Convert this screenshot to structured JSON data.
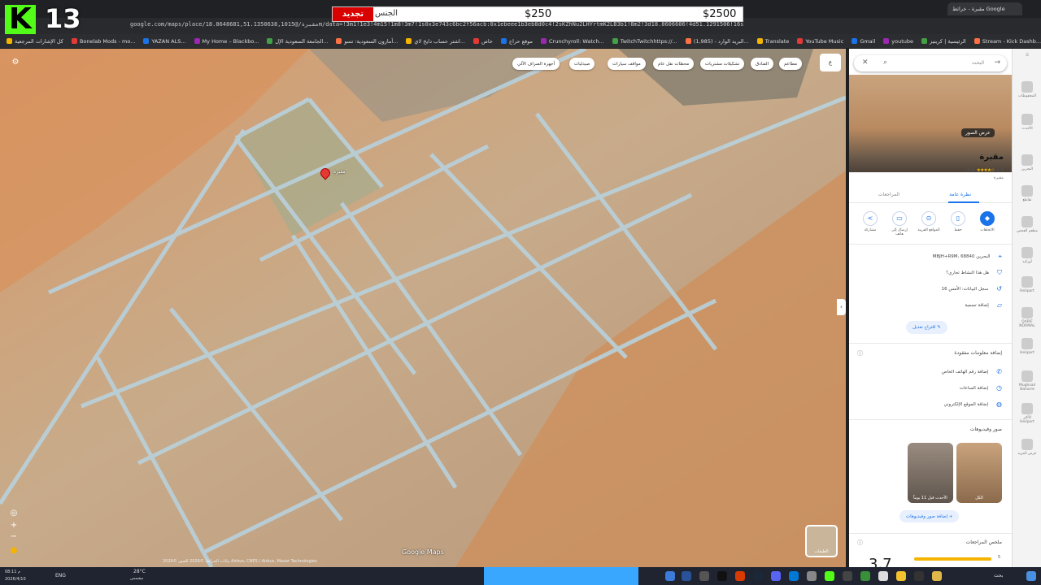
{
  "stream": {
    "logo_letter": "K",
    "count": "13",
    "overlay_red": "تجديد",
    "overlay_label": "الجنس",
    "price_small": "$250",
    "price_big": "$2500"
  },
  "browser": {
    "url": "google.com/maps/place/مقبرة/@18.8648681,51.1350638,1015m/data=!3m1!1e3!4m15!1m8!3m7!1s0x3e743c6bc2f56acb:0x1ebeee1b3eb8d0c4!2sKZhNu2LHYrtmK2LB3b1!8m2!3d18.8606606!4d51.1291506!16s",
    "active_tab": "مقبرة - خرائط Google",
    "bookmarks": [
      "كل الإشارات المرجعية",
      "Bonelab Mods - mo...",
      "YAZAN ALS...",
      "My Home – Blackbo...",
      "الجامعة السعودية الإل...",
      "أمازون السعودية: تسو...",
      "اشتر حساب دايخ لاي...",
      "خاص",
      "موقع حراج",
      "Crunchyroll: Watch...",
      "TwitchTwitchhttps://...",
      "(1,985) - البريد الوارد...",
      "Translate",
      "YouTube Music",
      "Gmail",
      "youtube",
      "الرئيسية | كريتيز",
      "Stream - Kick Dashb...",
      "Kick",
      "Google"
    ]
  },
  "map": {
    "chips": [
      "أجهزة الصراف الآلي",
      "صيدليات",
      "مواقف سيارات",
      "محطات نقل عام",
      "تشكيلات مشتريات",
      "الفنادق",
      "مطاعم"
    ],
    "pin_label": "مقبرة",
    "watermark": "Google Maps",
    "attribution": "بيانات الخرائط ©2026 الصور ©2026 Airbus, CNES / Airbus, Maxar Technologies",
    "layers_label": "الطبقات"
  },
  "panel": {
    "search_placeholder": "البحث",
    "photos_button": "عرض الصور",
    "place_name": "مقبرة",
    "rating": "3.7",
    "reviews": "(33)",
    "place_type": "مقبرة",
    "tabs": {
      "overview": "نظرة عامة",
      "reviews": "المراجعات"
    },
    "actions": [
      "الاتجاهات",
      "حفظ",
      "المواقع القريبة",
      "إرسال إلى هاتف",
      "مشاركة"
    ],
    "info": [
      "MBJH+R9M، البحرين 68840",
      "هل هذا النشاط تجاري؟",
      "سجل البيانات: الأمس 16",
      "إضافة تسمية"
    ],
    "edit_button": "اقتراح تعديل",
    "add_info_title": "إضافة معلومات مفقودة",
    "add_info": [
      "إضافة رقم الهاتف الخاص",
      "إضافة الساعات",
      "إضافة الموقع الإلكتروني"
    ],
    "photos_title": "صور وفيديوهات",
    "photo_tiles": [
      "الكل",
      "الأحدث قبل 11 يوماً"
    ],
    "add_photo": "إضافة صور وفيديوهات",
    "reviews_title": "ملخص المراجعات",
    "big_rating": "3.7",
    "bar_label": "5"
  },
  "rail": [
    "المحفوظات",
    "الأحدث",
    "البحرين",
    "تقاطع",
    "مطعم الفحص",
    "أوركيد",
    "Heliport",
    "QARIF NORMAL",
    "Heliport",
    "Mughsail Baharre",
    "الأكثر Heliport",
    "عرض المزيد"
  ],
  "taskbar": {
    "lang": "ENG",
    "temp": "28°C",
    "weather": "مشمس",
    "time": "08:11 م",
    "date": "2026/4/10",
    "search": "بحث"
  },
  "colors": {
    "accent": "#1a73e8",
    "star": "#f4b400",
    "kick": "#53fc18"
  }
}
